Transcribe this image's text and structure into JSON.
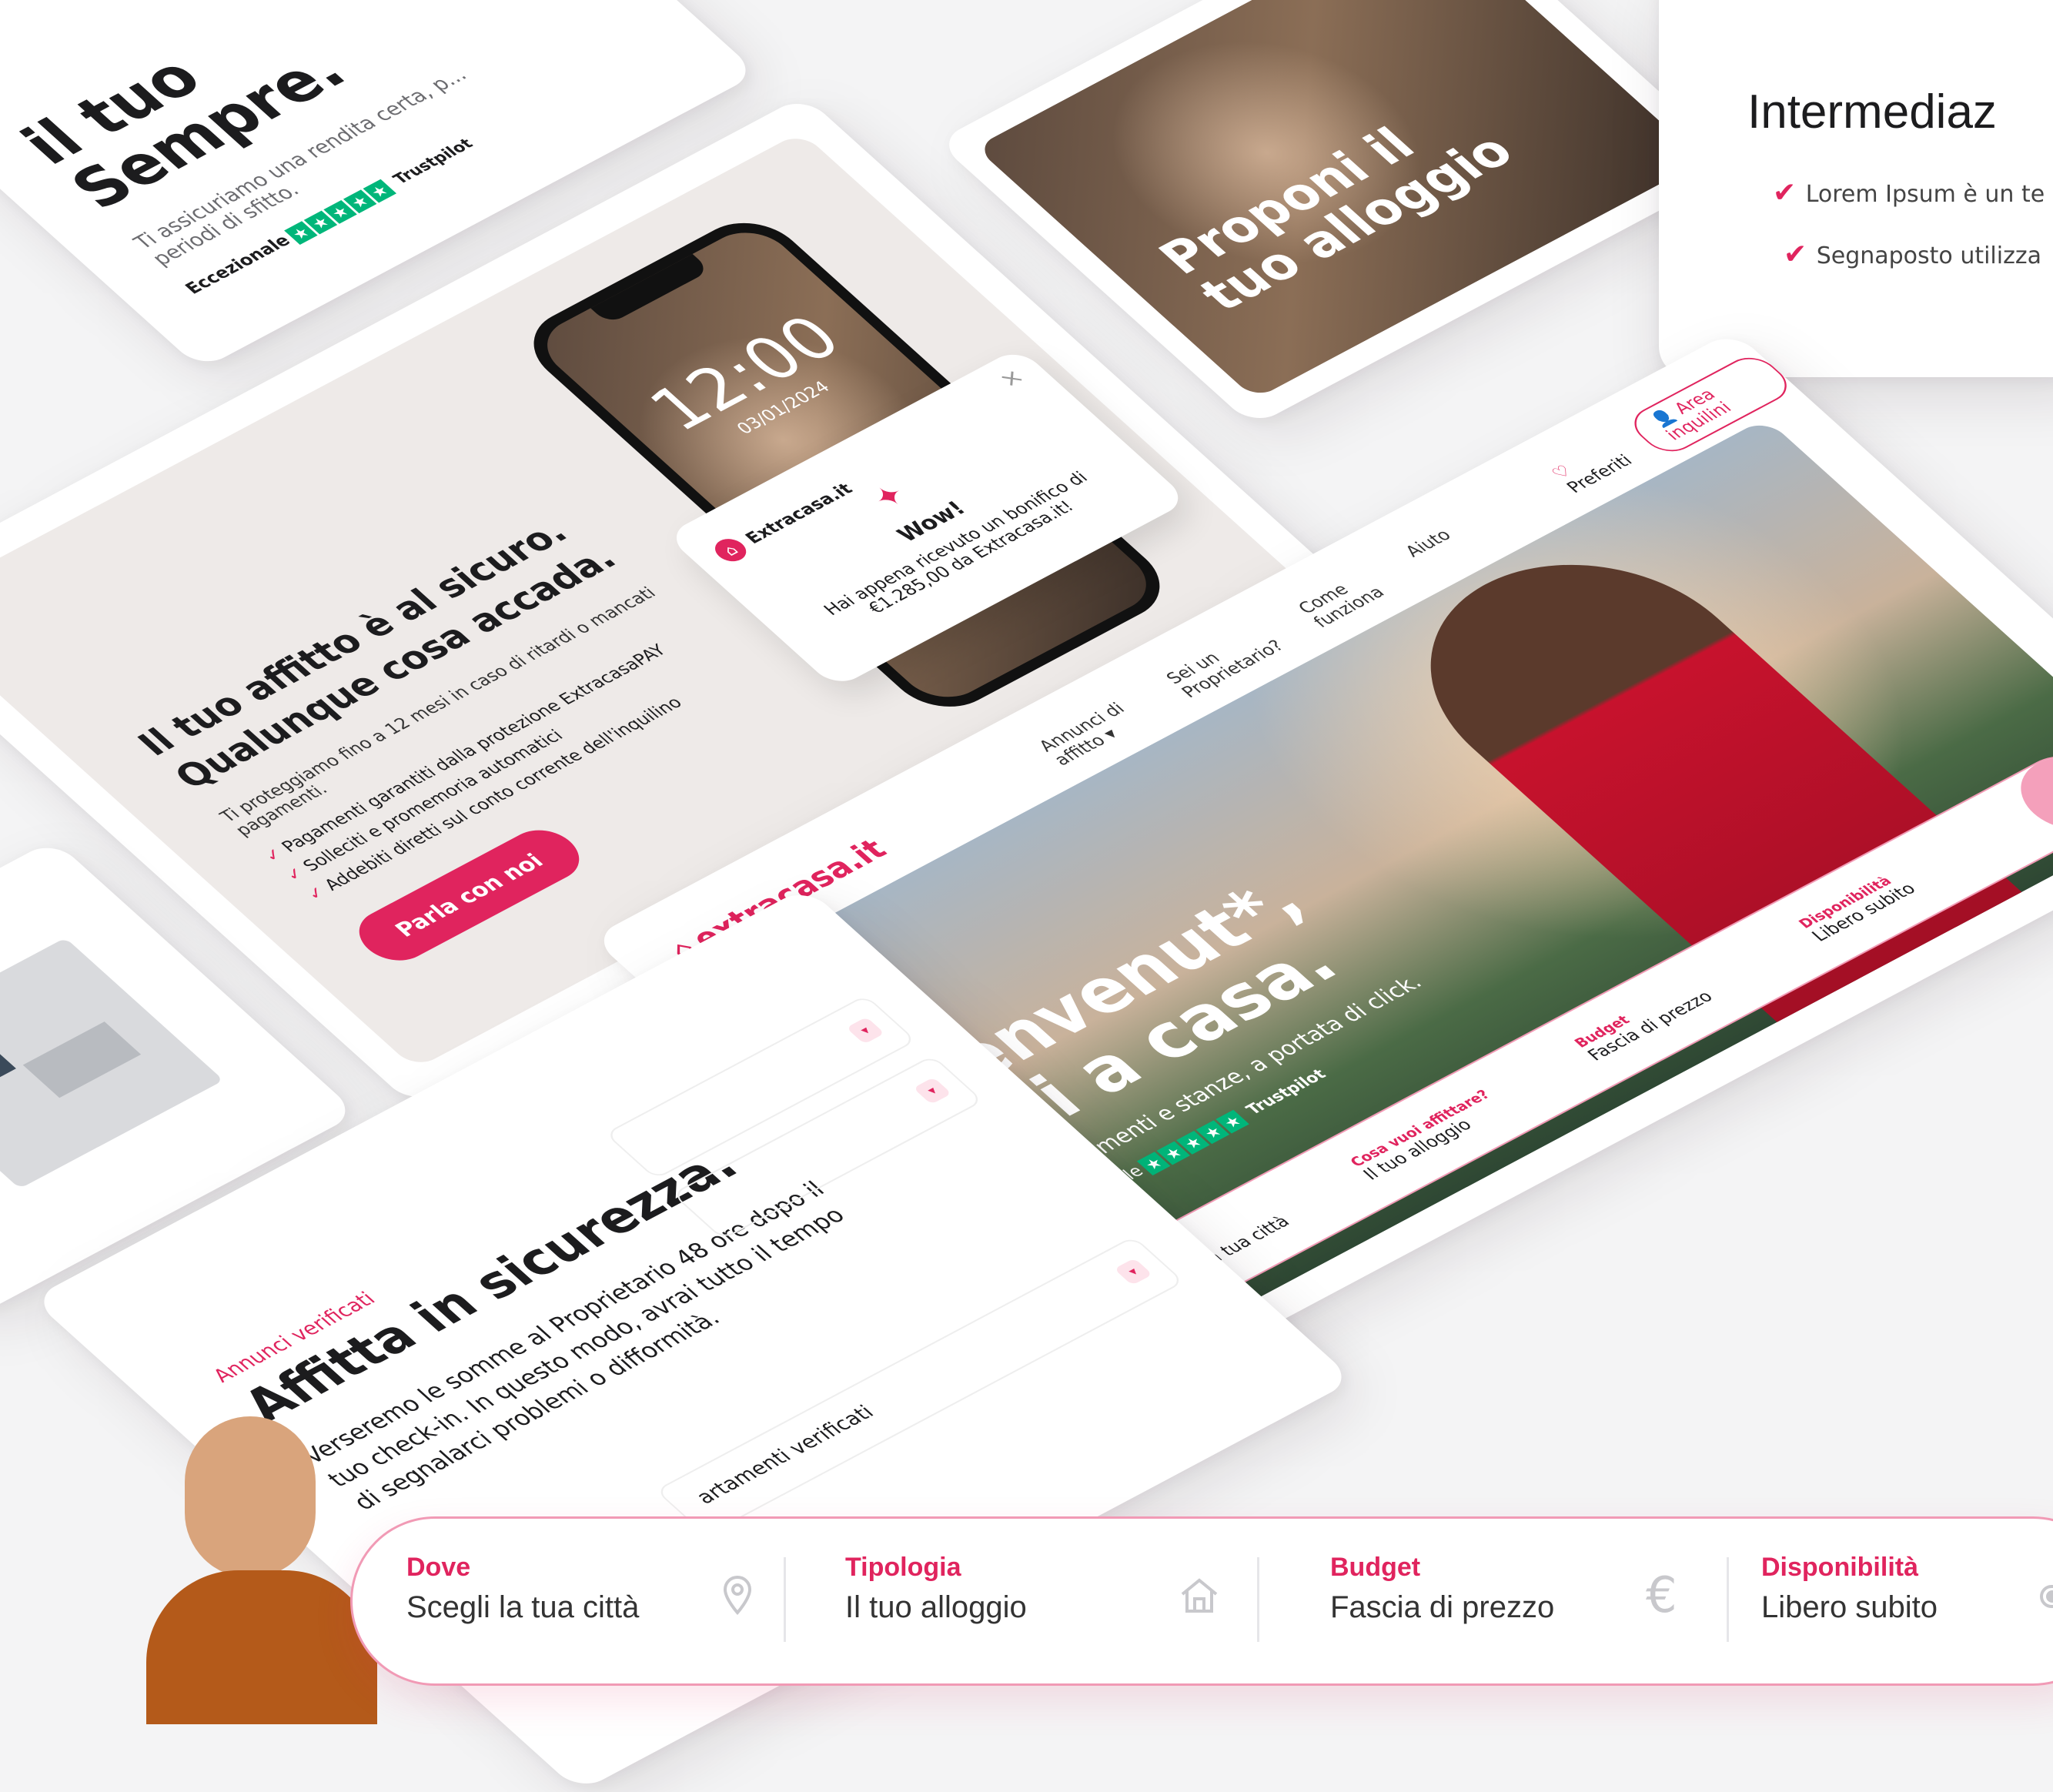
{
  "brand": {
    "name": "extracasa.it",
    "accent": "#e0245e"
  },
  "card_top_left": {
    "title_line1": "il tuo",
    "title_line2": "Sempre.",
    "body": "Ti assicuriamo una rendita certa, p... periodi di sfitto.",
    "rating_label": "Eccezionale",
    "trustpilot": "Trustpilot"
  },
  "card_protection": {
    "title_line1": "Il tuo affitto è al sicuro.",
    "title_line2": "Qualunque cosa accada.",
    "intro": "Ti proteggiamo fino a 12 mesi in caso di ritardi o mancati pagamenti.",
    "items": [
      "Pagamenti garantiti dalla protezione ExtracasaPAY",
      "Solleciti e promemoria automatici",
      "Addebiti diretti sul conto corrente dell'inquilino"
    ],
    "cta": "Parla con noi",
    "phone_time": "12:00",
    "phone_date": "03/01/2024",
    "notification_app": "Extracasa.it",
    "notification_title": "Wow!",
    "notification_body": "Hai appena ricevuto un bonifico di €1.285,00 da Extracasa.it!",
    "notification_close": "×"
  },
  "card_propose": {
    "title": "Proponi il tuo alloggio"
  },
  "card_intermediation": {
    "title": "Intermediaz",
    "items": [
      "Lorem Ipsum è un te",
      "Segnaposto utilizza"
    ]
  },
  "card_hero": {
    "nav": [
      "Annunci di affitto ▾",
      "Sei un Proprietario?",
      "Come funziona",
      "Aiuto"
    ],
    "favorites": "Preferiti",
    "account": "Area inquilini",
    "headline_line1": "Benvenut*,",
    "headline_line2": "sei a casa.",
    "subtitle": "Appartamenti e stanze, a portata di click.",
    "rating_label": "Eccezionale",
    "trustpilot": "Trustpilot",
    "search_fields": [
      {
        "label": "Dove",
        "value": "Scegli la tua città"
      },
      {
        "label": "Cosa vuoi affittare?",
        "value": "Il tuo alloggio"
      },
      {
        "label": "Budget",
        "value": "Fascia di prezzo"
      },
      {
        "label": "Disponibilità",
        "value": "Libero subito"
      }
    ]
  },
  "card_safety": {
    "eyebrow": "Annunci verificati",
    "title": "Affitta in sicurezza.",
    "body": "Verseremo le somme al Proprietario 48 ore dopo il tuo check-in. In questo modo, avrai tutto il tempo di segnalarci problemi o difformità.",
    "accordion_partial": "artamenti verificati"
  },
  "search_bar": {
    "segments": [
      {
        "label": "Dove",
        "value": "Scegli la tua città",
        "icon": "location-pin-icon"
      },
      {
        "label": "Tipologia",
        "value": "Il tuo alloggio",
        "icon": "house-icon"
      },
      {
        "label": "Budget",
        "value": "Fascia di prezzo",
        "icon": "euro-icon"
      },
      {
        "label": "Disponibilità",
        "value": "Libero subito",
        "icon": "toggle-icon"
      }
    ]
  }
}
